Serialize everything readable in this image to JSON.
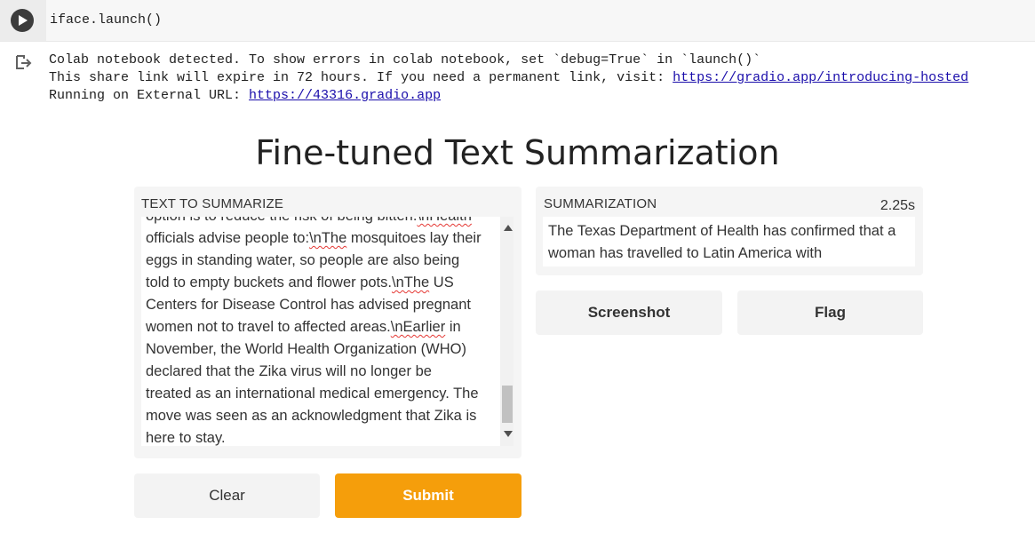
{
  "cell": {
    "code": "iface.launch()"
  },
  "output": {
    "line1": "Colab notebook detected. To show errors in colab notebook, set `debug=True` in `launch()`",
    "line2_prefix": "This share link will expire in 72 hours. If you need a permanent link, visit: ",
    "line2_link": "https://gradio.app/introducing-hosted",
    "line3_prefix": "Running on External URL: ",
    "line3_link": "https://43316.gradio.app"
  },
  "app": {
    "title": "Fine-tuned Text Summarization",
    "input_label": "TEXT TO SUMMARIZE",
    "input_lines": [
      "option is to reduce the risk of being bitten.\\nHealth",
      "officials advise people to:\\nThe mosquitoes lay their",
      "eggs in standing water, so people are also being",
      "told to empty buckets and flower pots.\\nThe US",
      "Centers for Disease Control has advised pregnant",
      "women not to travel to affected areas.\\nEarlier in",
      "November, the World Health Organization (WHO)",
      "declared that the Zika virus will no longer be",
      "treated as an international medical emergency. The",
      "move was seen as an acknowledgment that Zika is",
      "here to stay."
    ],
    "output_label": "SUMMARIZATION",
    "timing": "2.25s",
    "output_text": "The Texas Department of Health has confirmed that a woman has travelled to Latin America with",
    "buttons": {
      "clear": "Clear",
      "submit": "Submit",
      "screenshot": "Screenshot",
      "flag": "Flag"
    },
    "colors": {
      "submit": "#f59e0b",
      "panel": "#f5f5f5"
    }
  }
}
